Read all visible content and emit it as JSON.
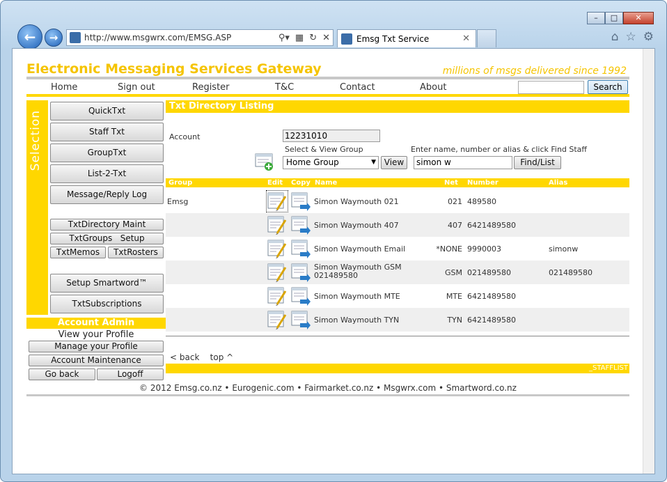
{
  "browser": {
    "url": "http://www.msgwrx.com/EMSG.ASP",
    "tab_title": "Emsg Txt Service"
  },
  "site": {
    "title": "Electronic Messaging Services Gateway",
    "slogan": "millions of msgs delivered since 1992"
  },
  "topnav": [
    "Home",
    "Sign out",
    "Register",
    "T&C",
    "Contact",
    "About"
  ],
  "search": {
    "button": "Search",
    "value": ""
  },
  "selection": {
    "label": "Selection",
    "buttons": [
      "QuickTxt",
      "Staff Txt",
      "GroupTxt",
      "List-2-Txt",
      "Message/Reply Log"
    ],
    "small": {
      "directory": "TxtDirectory Maint",
      "groups": "TxtGroups   Setup",
      "memos": "TxtMemos",
      "rosters": "TxtRosters"
    },
    "bottom": [
      "Setup Smartword™",
      "TxtSubscriptions"
    ]
  },
  "account_admin": {
    "header": "Account Admin",
    "view_profile": "View your Profile",
    "manage": "Manage your Profile",
    "maintenance": "Account Maintenance",
    "go_back": "Go back",
    "logoff": "Logoff"
  },
  "main": {
    "title": "Txt Directory Listing",
    "account_label": "Account",
    "account_value": "12231010",
    "group_label": "Select & View Group",
    "group_value": "Home Group",
    "view_button": "View",
    "find_label": "Enter name, number or alias & click Find Staff",
    "find_value": "simon w",
    "find_button": "Find/List",
    "columns": {
      "group": "Group",
      "edit": "Edit",
      "copy": "Copy",
      "name": "Name",
      "net": "Net",
      "number": "Number",
      "alias": "Alias"
    },
    "rows": [
      {
        "group": "Emsg",
        "name": "Simon Waymouth 021",
        "name2": "",
        "net": "021",
        "number": "489580",
        "alias": ""
      },
      {
        "group": "",
        "name": "Simon Waymouth 407",
        "name2": "",
        "net": "407",
        "number": "6421489580",
        "alias": ""
      },
      {
        "group": "",
        "name": "Simon Waymouth Email",
        "name2": "",
        "net": "*NONE",
        "number": "9990003",
        "alias": "simonw"
      },
      {
        "group": "",
        "name": "Simon Waymouth GSM",
        "name2": "021489580",
        "net": "GSM",
        "number": "021489580",
        "alias": "021489580"
      },
      {
        "group": "",
        "name": "Simon Waymouth MTE",
        "name2": "",
        "net": "MTE",
        "number": "6421489580",
        "alias": ""
      },
      {
        "group": "",
        "name": "Simon Waymouth TYN",
        "name2": "",
        "net": "TYN",
        "number": "6421489580",
        "alias": ""
      }
    ],
    "back": "< back",
    "top": "top ^",
    "footer_tag": "_STAFFLIST"
  },
  "copyright": "© 2012 Emsg.co.nz • Eurogenic.com • Fairmarket.co.nz • Msgwrx.com • Smartword.co.nz"
}
